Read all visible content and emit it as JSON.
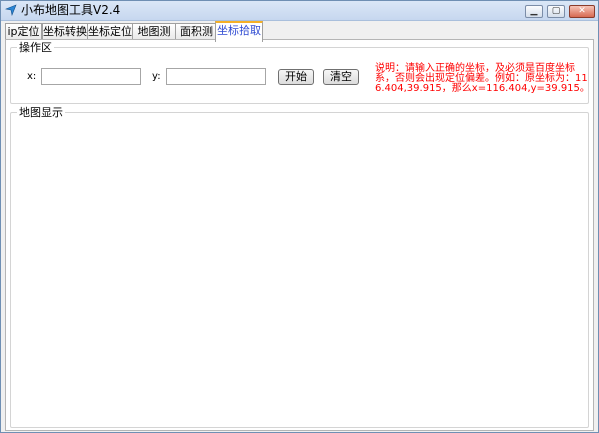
{
  "window": {
    "title": "小布地图工具V2.4"
  },
  "titlebar_buttons": {
    "minimize": "▁",
    "maximize": "▢",
    "close": "✕"
  },
  "tabs": [
    {
      "label": "ip定位"
    },
    {
      "label": "坐标转换"
    },
    {
      "label": "坐标定位"
    },
    {
      "label": "地图测距"
    },
    {
      "label": "面积测量"
    },
    {
      "label": "坐标拾取",
      "active": true
    }
  ],
  "operation": {
    "legend": "操作区",
    "x_label": "x:",
    "x_value": "",
    "y_label": "y:",
    "y_value": "",
    "start_label": "开始",
    "clear_label": "清空",
    "note": "说明：请输入正确的坐标，及必须是百度坐标系，否则会出现定位偏差。例如：原坐标为：116.404,39.915，那么x=116.404,y=39.915。"
  },
  "map": {
    "legend": "地图显示"
  },
  "colors": {
    "active_tab_text": "#2f4bd2",
    "active_tab_accent": "#f5b027",
    "note": "#ff0000",
    "title_bar": "#c6d7ef"
  }
}
